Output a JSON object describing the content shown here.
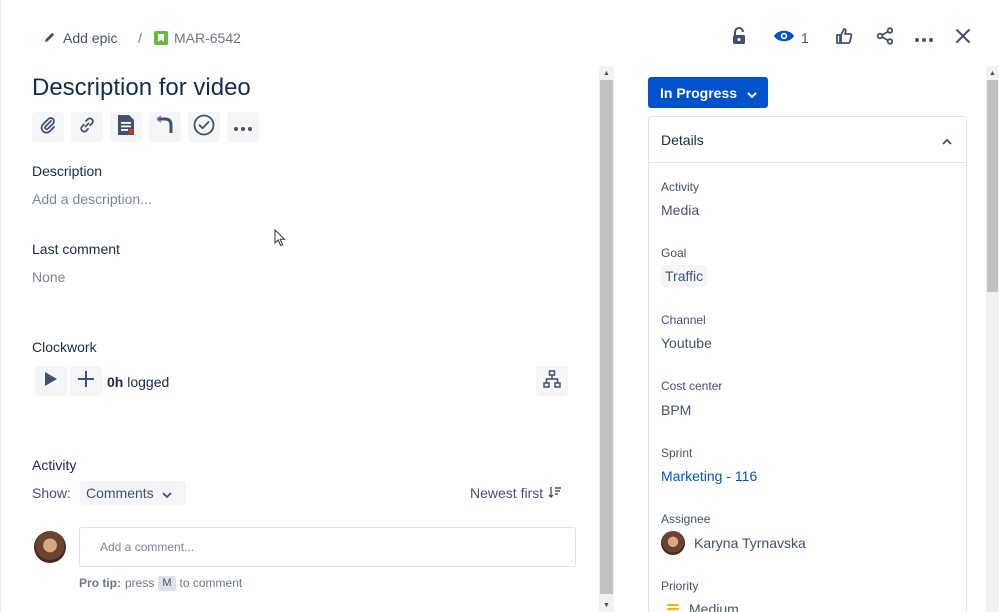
{
  "header": {
    "add_epic_label": "Add epic",
    "separator": "/",
    "issue_key": "MAR-6542",
    "watch_count": "1"
  },
  "issue": {
    "title": "Description for video"
  },
  "description": {
    "label": "Description",
    "placeholder": "Add a description..."
  },
  "last_comment": {
    "label": "Last comment",
    "value": "None"
  },
  "clockwork": {
    "label": "Clockwork",
    "logged_amount": "0h",
    "logged_suffix": " logged"
  },
  "activity": {
    "label": "Activity",
    "show_label": "Show:",
    "filter_value": "Comments",
    "sort_label": "Newest first",
    "comment_placeholder": "Add a comment...",
    "protip_prefix": "Pro tip:",
    "protip_press": "press",
    "protip_key": "M",
    "protip_suffix": "to comment"
  },
  "status": {
    "label": "In Progress",
    "color": "#0052cc"
  },
  "details": {
    "title": "Details",
    "fields": {
      "activity": {
        "label": "Activity",
        "value": "Media"
      },
      "goal": {
        "label": "Goal",
        "value": "Traffic"
      },
      "channel": {
        "label": "Channel",
        "value": "Youtube"
      },
      "cost_center": {
        "label": "Cost center",
        "value": "BPM"
      },
      "sprint": {
        "label": "Sprint",
        "value": "Marketing - 116"
      },
      "assignee": {
        "label": "Assignee",
        "value": "Karyna Tyrnavska"
      },
      "priority": {
        "label": "Priority",
        "value": "Medium"
      }
    }
  },
  "icons": {
    "header": [
      "pencil-icon",
      "story-icon",
      "lock-icon",
      "eye-icon",
      "thumbs-up-icon",
      "share-icon",
      "more-icon",
      "close-icon"
    ],
    "toolbar": [
      "attachment-icon",
      "link-icon",
      "confluence-page-icon",
      "branch-icon",
      "checklist-icon",
      "more-icon"
    ],
    "clockwork": [
      "play-icon",
      "plus-icon",
      "hierarchy-icon"
    ]
  }
}
